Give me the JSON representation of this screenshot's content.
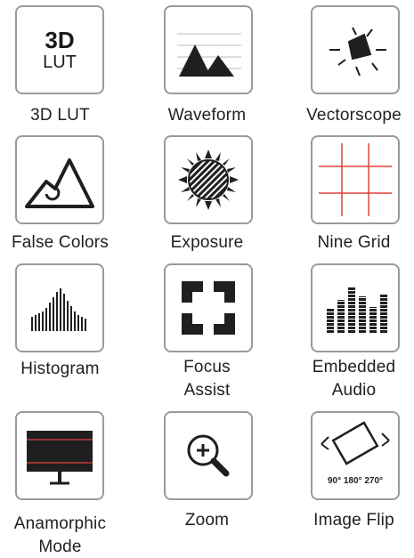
{
  "tiles": [
    {
      "id": "3d-lut",
      "label_lines": [
        "3D LUT"
      ],
      "icon": "3d-lut-icon",
      "icon_text": {
        "big": "3D",
        "small": "LUT"
      }
    },
    {
      "id": "waveform",
      "label_lines": [
        "Waveform"
      ],
      "icon": "waveform-icon"
    },
    {
      "id": "vectorscope",
      "label_lines": [
        "Vectorscope"
      ],
      "icon": "vectorscope-icon"
    },
    {
      "id": "false-colors",
      "label_lines": [
        "False Colors"
      ],
      "icon": "false-colors-icon"
    },
    {
      "id": "exposure",
      "label_lines": [
        "Exposure"
      ],
      "icon": "exposure-icon"
    },
    {
      "id": "nine-grid",
      "label_lines": [
        "Nine Grid"
      ],
      "icon": "nine-grid-icon"
    },
    {
      "id": "histogram",
      "label_lines": [
        "Histogram"
      ],
      "icon": "histogram-icon"
    },
    {
      "id": "focus-assist",
      "label_lines": [
        "Focus",
        "Assist"
      ],
      "icon": "focus-assist-icon"
    },
    {
      "id": "embedded-audio",
      "label_lines": [
        "Embedded",
        "Audio"
      ],
      "icon": "embedded-audio-icon"
    },
    {
      "id": "anamorphic-mode",
      "label_lines": [
        "Anamorphic",
        "Mode"
      ],
      "icon": "anamorphic-mode-icon"
    },
    {
      "id": "zoom",
      "label_lines": [
        "Zoom"
      ],
      "icon": "zoom-icon"
    },
    {
      "id": "image-flip",
      "label_lines": [
        "Image Flip"
      ],
      "icon": "image-flip-icon",
      "icon_text": {
        "angles": "90° 180° 270°"
      }
    }
  ],
  "colors": {
    "border": "#9a9a9a",
    "icon": "#1f1f1f",
    "guide_red": "#e0403a"
  }
}
